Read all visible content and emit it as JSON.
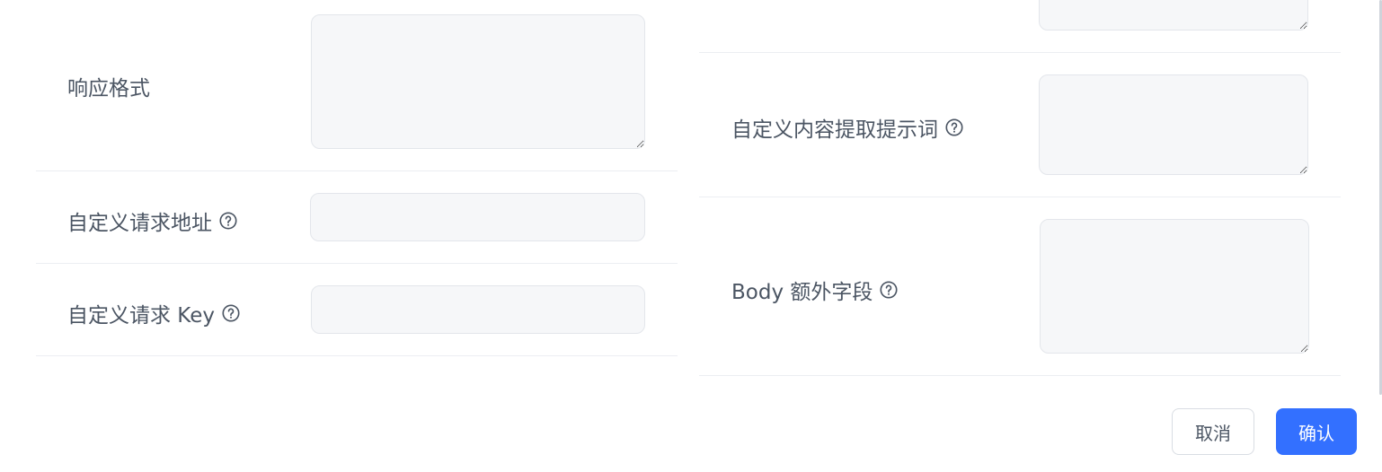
{
  "left_form": {
    "response_format": {
      "label": "响应格式",
      "value": ""
    },
    "custom_request_url": {
      "label": "自定义请求地址",
      "value": ""
    },
    "custom_request_key": {
      "label": "自定义请求 Key",
      "value": ""
    }
  },
  "right_form": {
    "top_field": {
      "value": ""
    },
    "custom_extract_prompt": {
      "label": "自定义内容提取提示词",
      "value": ""
    },
    "body_extra_fields": {
      "label": "Body 额外字段",
      "value": ""
    }
  },
  "footer": {
    "cancel_label": "取消",
    "confirm_label": "确认"
  },
  "icons": {
    "help": "question-circle-icon"
  },
  "colors": {
    "primary": "#3370ff",
    "field_bg": "#f6f7f9",
    "label": "#4b5563",
    "divider": "#eceef2"
  }
}
